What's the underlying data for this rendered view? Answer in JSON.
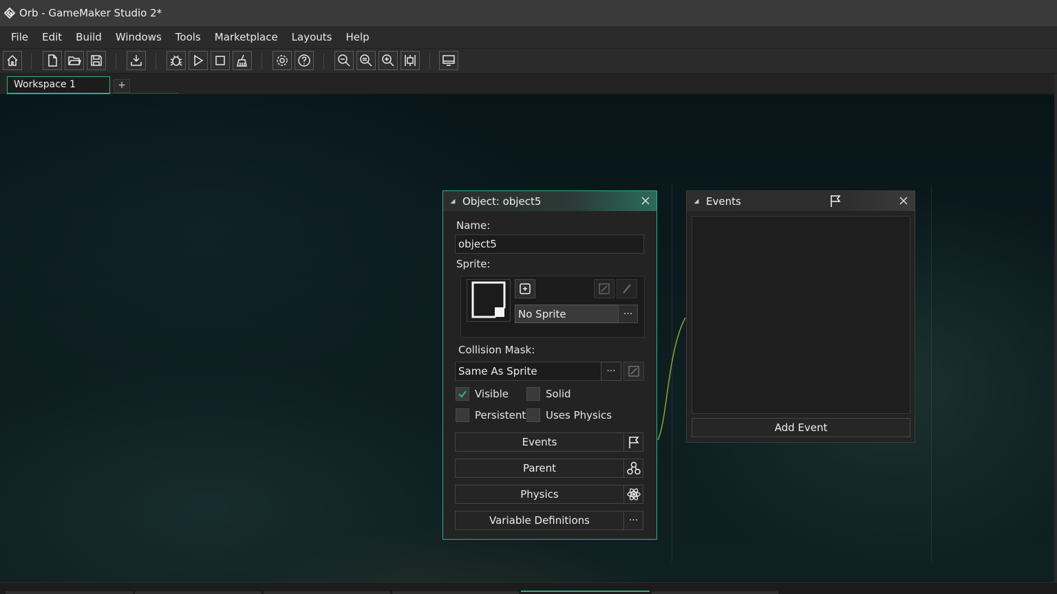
{
  "window": {
    "title": "Orb - GameMaker Studio 2*"
  },
  "menu": {
    "items": [
      "File",
      "Edit",
      "Build",
      "Windows",
      "Tools",
      "Marketplace",
      "Layouts",
      "Help"
    ]
  },
  "toolbar": {
    "icons": [
      "home-icon",
      "new-project-icon",
      "open-project-icon",
      "save-icon",
      "create-executable-icon",
      "debug-icon",
      "run-icon",
      "stop-icon",
      "clean-icon",
      "game-options-icon",
      "help-icon",
      "zoom-out-icon",
      "zoom-reset-icon",
      "zoom-in-icon",
      "fit-view-icon",
      "display-icon"
    ]
  },
  "tabs": {
    "workspace_label": "Workspace 1",
    "add_label": "+"
  },
  "object_window": {
    "title": "Object: object5",
    "name_label": "Name:",
    "name_value": "object5",
    "sprite_label": "Sprite:",
    "sprite_value": "No Sprite",
    "collision_label": "Collision Mask:",
    "collision_value": "Same As Sprite",
    "dots": "···",
    "checkboxes": {
      "visible": {
        "label": "Visible",
        "checked": true
      },
      "solid": {
        "label": "Solid",
        "checked": false
      },
      "persistent": {
        "label": "Persistent",
        "checked": false
      },
      "uses_physics": {
        "label": "Uses Physics",
        "checked": false
      }
    },
    "buttons": {
      "events": "Events",
      "parent": "Parent",
      "physics": "Physics",
      "variable_definitions": "Variable Definitions"
    }
  },
  "events_window": {
    "title": "Events",
    "add_event": "Add Event"
  },
  "colors": {
    "accent": "#2db08c",
    "check": "#2db08c"
  }
}
